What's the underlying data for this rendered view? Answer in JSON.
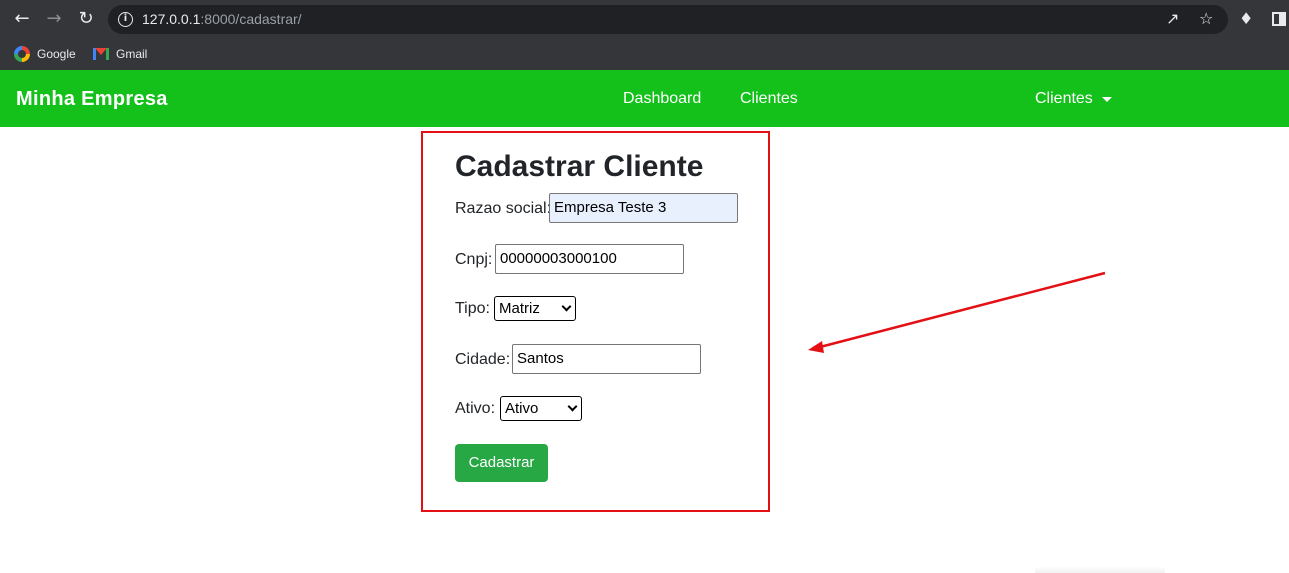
{
  "browser": {
    "url_host": "127.0.0.1",
    "url_rest": ":8000/cadastrar/",
    "bookmarks": [
      {
        "label": "Google",
        "icon": "google-icon"
      },
      {
        "label": "Gmail",
        "icon": "gmail-icon"
      }
    ]
  },
  "navbar": {
    "brand": "Minha Empresa",
    "links": [
      "Dashboard",
      "Clientes"
    ],
    "dropdown_label": "Clientes",
    "color": "#14c01a"
  },
  "form": {
    "title": "Cadastrar Cliente",
    "razao_social_label": "Razao social:",
    "razao_social_value": "Empresa Teste 3",
    "cnpj_label": "Cnpj:",
    "cnpj_value": "00000003000100",
    "tipo_label": "Tipo:",
    "tipo_value": "Matriz",
    "cidade_label": "Cidade:",
    "cidade_value": "Santos",
    "ativo_label": "Ativo:",
    "ativo_value": "Ativo",
    "submit_label": "Cadastrar",
    "submit_color": "#28a745"
  },
  "annotation": {
    "box_color": "#e31016",
    "arrow_color": "#e31016"
  }
}
